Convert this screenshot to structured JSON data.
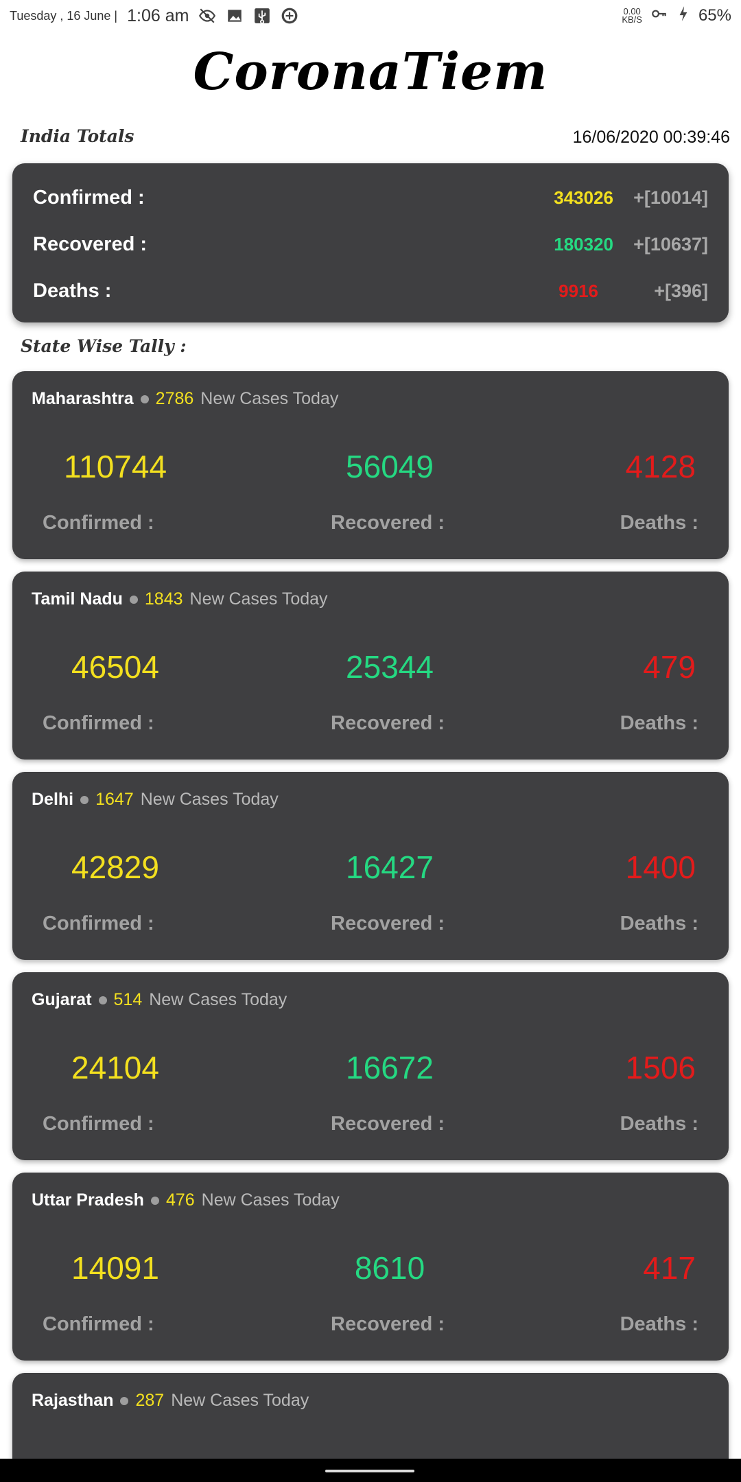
{
  "status_bar": {
    "date": "Tuesday , 16 June |",
    "time": "1:06 am",
    "speed_value": "0.00",
    "speed_unit": "KB/S",
    "battery": "65%",
    "icons": [
      "eye-off-icon",
      "image-icon",
      "usb-icon",
      "data-saver-icon",
      "vpn-key-icon",
      "charging-icon"
    ]
  },
  "app": {
    "title": "CoronaTiem"
  },
  "india": {
    "label": "India Totals",
    "updated": "16/06/2020 00:39:46",
    "confirmed_label": "Confirmed :",
    "confirmed": "343026",
    "confirmed_delta": "+[10014]",
    "recovered_label": "Recovered :",
    "recovered": "180320",
    "recovered_delta": "+[10637]",
    "deaths_label": "Deaths :",
    "deaths": "9916",
    "deaths_delta": "+[396]"
  },
  "colors": {
    "confirmed": "#f3e01f",
    "recovered": "#25d982",
    "deaths": "#e31b1b",
    "card": "#3f3f41"
  },
  "state_section": {
    "label": "State Wise Tally :"
  },
  "captions": {
    "confirmed": "Confirmed :",
    "recovered": "Recovered :",
    "deaths": "Deaths :",
    "new_cases": "New Cases Today"
  },
  "states": [
    {
      "name": "Maharashtra",
      "new": "2786",
      "confirmed": "110744",
      "recovered": "56049",
      "deaths": "4128"
    },
    {
      "name": "Tamil Nadu",
      "new": "1843",
      "confirmed": "46504",
      "recovered": "25344",
      "deaths": "479"
    },
    {
      "name": "Delhi",
      "new": "1647",
      "confirmed": "42829",
      "recovered": "16427",
      "deaths": "1400"
    },
    {
      "name": "Gujarat",
      "new": "514",
      "confirmed": "24104",
      "recovered": "16672",
      "deaths": "1506"
    },
    {
      "name": "Uttar Pradesh",
      "new": "476",
      "confirmed": "14091",
      "recovered": "8610",
      "deaths": "417"
    },
    {
      "name": "Rajasthan",
      "new": "287",
      "confirmed": "",
      "recovered": "",
      "deaths": ""
    }
  ]
}
